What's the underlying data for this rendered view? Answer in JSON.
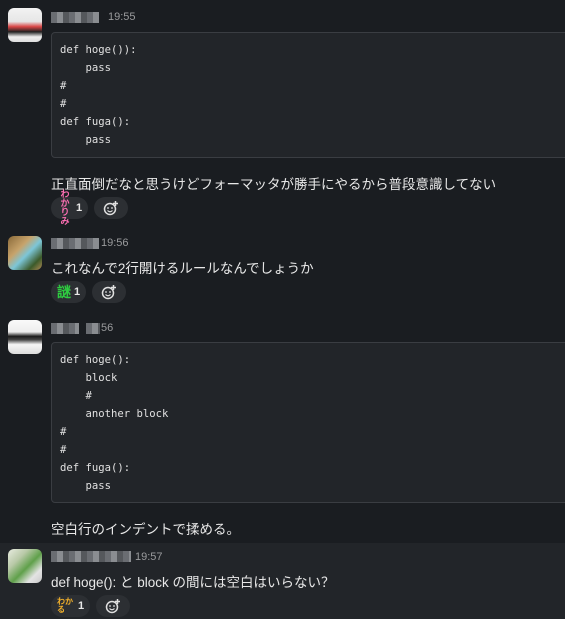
{
  "messages": [
    {
      "time": "19:55",
      "code_lines": [
        "def hoge()):",
        "    pass",
        "#",
        "#",
        "def fuga():",
        "    pass"
      ],
      "text": "正直面倒だなと思うけどフォーマッタが勝手にやるから普段意識してない",
      "reactions": [
        {
          "emoji_text": "わか りみ",
          "count": "1"
        }
      ]
    },
    {
      "time": "19:56",
      "text": "これなんで2行開けるルールなんでしょうか",
      "reactions": [
        {
          "emoji_text": "謎",
          "count": "1"
        }
      ]
    },
    {
      "time": "56",
      "code_lines": [
        "def hoge():",
        "    block",
        "    #",
        "    another block",
        "#",
        "#",
        "def fuga():",
        "    pass"
      ],
      "text": "空白行のインデントで揉める。"
    },
    {
      "time": "19:57",
      "text": "def hoge(): と block の間には空白はいらない？",
      "reactions": [
        {
          "emoji_text": "わかる",
          "count": "1"
        }
      ]
    }
  ],
  "icons": {
    "add_reaction": "add-reaction-icon"
  },
  "colors": {
    "background": "#1a1d21",
    "code_bg": "#222529",
    "reaction_bg": "#2c2f33"
  }
}
